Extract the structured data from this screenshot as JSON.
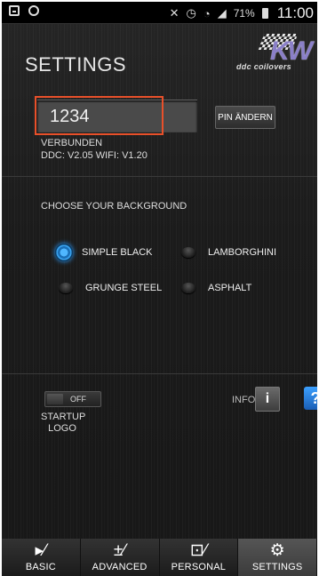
{
  "status_bar": {
    "battery": "71%",
    "time": "11:00"
  },
  "header": {
    "title": "SETTINGS",
    "logo_text": "KW",
    "logo_sub": "ddc coilovers"
  },
  "pin": {
    "value": "1234",
    "button_label": "PIN ÄNDERN",
    "status": "VERBUNDEN",
    "versions": "DDC: V2.05  WIFI: V1.20"
  },
  "background": {
    "heading": "CHOOSE YOUR BACKGROUND",
    "options": [
      {
        "label": "SIMPLE BLACK",
        "checked": true
      },
      {
        "label": "LAMBORGHINI",
        "checked": false
      },
      {
        "label": "GRUNGE STEEL",
        "checked": false
      },
      {
        "label": "ASPHALT",
        "checked": false
      }
    ]
  },
  "startup": {
    "toggle_state": "OFF",
    "label_line1": "STARTUP",
    "label_line2": "LOGO"
  },
  "info": {
    "label": "INFO",
    "button_glyph": "i",
    "help_glyph": "?"
  },
  "tabs": [
    {
      "label": "BASIC",
      "icon": "basic-icon",
      "active": false
    },
    {
      "label": "ADVANCED",
      "icon": "advanced-icon",
      "active": false
    },
    {
      "label": "PERSONAL",
      "icon": "personal-lock-icon",
      "active": false
    },
    {
      "label": "SETTINGS",
      "icon": "gear-icon",
      "active": true
    }
  ],
  "colors": {
    "highlight_border": "#e8502a",
    "radio_active": "#2d9cff",
    "help_button": "#2a7ee0"
  }
}
